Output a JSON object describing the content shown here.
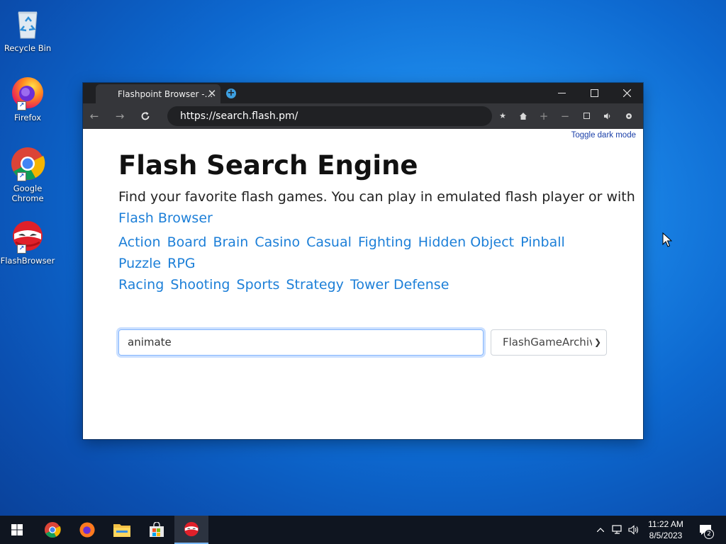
{
  "desktop": {
    "icons": [
      {
        "label": "Recycle Bin"
      },
      {
        "label": "Firefox"
      },
      {
        "label": "Google Chrome"
      },
      {
        "label": "FlashBrowser"
      }
    ]
  },
  "browser": {
    "tab_title": "Flashpoint Browser -...",
    "tab_close": "✕",
    "url": "https://search.flash.pm/"
  },
  "page": {
    "toggle_dark_mode": "Toggle dark mode",
    "title": "Flash Search Engine",
    "tagline": "Find your favorite flash games. You can play in emulated flash player or with",
    "flash_browser_link": "Flash Browser",
    "categories": [
      "Action",
      "Board",
      "Brain",
      "Casino",
      "Casual",
      "Fighting",
      "Hidden Object",
      "Pinball",
      "Puzzle",
      "RPG",
      "Racing",
      "Shooting",
      "Sports",
      "Strategy",
      "Tower Defense"
    ],
    "search_value": "animate",
    "source_select_value": "FlashGameArchive"
  },
  "taskbar": {
    "time": "11:22 AM",
    "date": "8/5/2023",
    "notification_count": "2"
  },
  "colors": {
    "link": "#1c7fd8",
    "titlebar": "#1f2023",
    "toolbar": "#35363a"
  }
}
